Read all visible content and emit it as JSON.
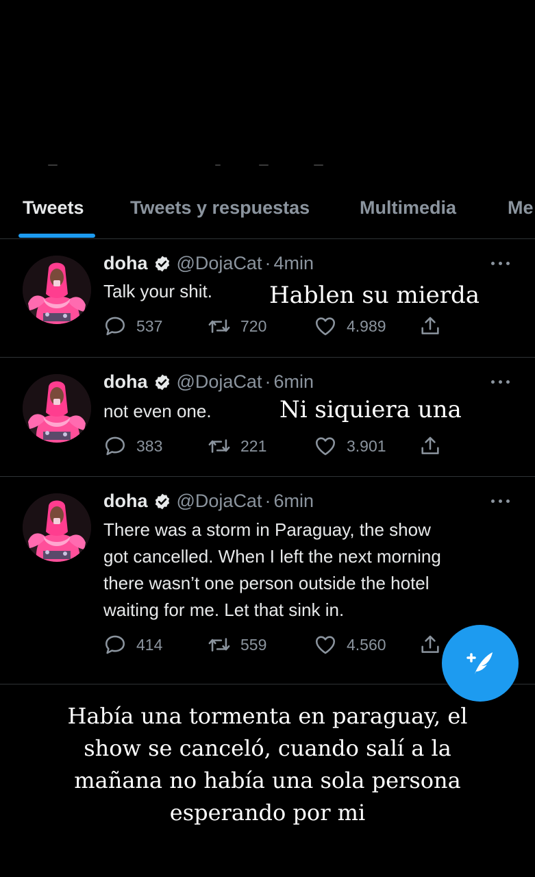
{
  "tabs": [
    {
      "label": "Tweets",
      "active": true
    },
    {
      "label": "Tweets y respuestas",
      "active": false
    },
    {
      "label": "Multimedia",
      "active": false
    },
    {
      "label": "Me",
      "active": false
    }
  ],
  "accent_color": "#1d9bf0",
  "tweets": [
    {
      "name": "doha",
      "handle": "@DojaCat",
      "separator": "·",
      "time": "4min",
      "text": "Talk your shit.",
      "translation": "Hablen su mierda",
      "replies": "537",
      "retweets": "720",
      "likes": "4.989"
    },
    {
      "name": "doha",
      "handle": "@DojaCat",
      "separator": "·",
      "time": "6min",
      "text": "not even one.",
      "translation": "Ni siquiera una",
      "replies": "383",
      "retweets": "221",
      "likes": "3.901"
    },
    {
      "name": "doha",
      "handle": "@DojaCat",
      "separator": "·",
      "time": "6min",
      "text_lines": [
        "There was a storm in Paraguay, the show",
        "got cancelled. When I left the next morning",
        "there wasn’t one person outside the hotel",
        "waiting for me. Let that sink in."
      ],
      "replies": "414",
      "retweets": "559",
      "likes": "4.560"
    }
  ],
  "caption_lines": [
    "Había una tormenta en paraguay, el",
    "show se canceló, cuando salí a la",
    "mañana no había una sola persona",
    "esperando por mi"
  ],
  "icons": {
    "verified": "verified-badge-icon",
    "reply": "reply-icon",
    "retweet": "retweet-icon",
    "like": "heart-icon",
    "share": "share-icon",
    "more": "more-icon",
    "compose": "compose-tweet-icon"
  }
}
